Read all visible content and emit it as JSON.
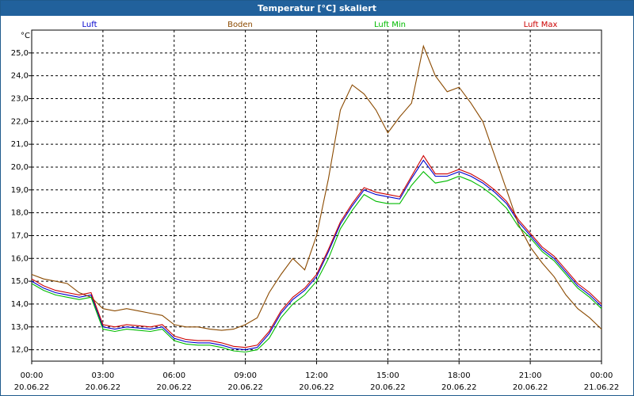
{
  "title": "Temperatur [°C] skaliert",
  "chart_data": {
    "type": "line",
    "title": "Temperatur [°C] skaliert",
    "ylabel": "°C",
    "xlabel": "",
    "ylim": [
      11.5,
      26.0
    ],
    "xlim": [
      0,
      24
    ],
    "grid": true,
    "legend": "top",
    "yticks": [
      "12,0",
      "13,0",
      "14,0",
      "15,0",
      "16,0",
      "17,0",
      "18,0",
      "19,0",
      "20,0",
      "21,0",
      "22,0",
      "23,0",
      "24,0",
      "25,0"
    ],
    "ytick_values": [
      12,
      13,
      14,
      15,
      16,
      17,
      18,
      19,
      20,
      21,
      22,
      23,
      24,
      25
    ],
    "xticks": [
      {
        "time": "00:00",
        "date": "20.06.22",
        "h": 0
      },
      {
        "time": "03:00",
        "date": "20.06.22",
        "h": 3
      },
      {
        "time": "06:00",
        "date": "20.06.22",
        "h": 6
      },
      {
        "time": "09:00",
        "date": "20.06.22",
        "h": 9
      },
      {
        "time": "12:00",
        "date": "20.06.22",
        "h": 12
      },
      {
        "time": "15:00",
        "date": "20.06.22",
        "h": 15
      },
      {
        "time": "18:00",
        "date": "20.06.22",
        "h": 18
      },
      {
        "time": "21:00",
        "date": "20.06.22",
        "h": 21
      },
      {
        "time": "00:00",
        "date": "21.06.22",
        "h": 24
      }
    ],
    "series": [
      {
        "name": "Luft",
        "color": "#0000cc",
        "points": [
          [
            0,
            15.0
          ],
          [
            0.5,
            14.7
          ],
          [
            1,
            14.5
          ],
          [
            1.5,
            14.4
          ],
          [
            2,
            14.3
          ],
          [
            2.5,
            14.4
          ],
          [
            3,
            13.0
          ],
          [
            3.5,
            12.9
          ],
          [
            4,
            13.0
          ],
          [
            4.5,
            12.95
          ],
          [
            5,
            12.9
          ],
          [
            5.5,
            13.0
          ],
          [
            6,
            12.5
          ],
          [
            6.5,
            12.35
          ],
          [
            7,
            12.3
          ],
          [
            7.5,
            12.3
          ],
          [
            8,
            12.2
          ],
          [
            8.5,
            12.05
          ],
          [
            9,
            12.0
          ],
          [
            9.5,
            12.1
          ],
          [
            10,
            12.7
          ],
          [
            10.5,
            13.6
          ],
          [
            11,
            14.2
          ],
          [
            11.5,
            14.6
          ],
          [
            12,
            15.2
          ],
          [
            12.5,
            16.3
          ],
          [
            13,
            17.5
          ],
          [
            13.5,
            18.3
          ],
          [
            14,
            19.0
          ],
          [
            14.5,
            18.8
          ],
          [
            15,
            18.7
          ],
          [
            15.5,
            18.6
          ],
          [
            16,
            19.5
          ],
          [
            16.5,
            20.3
          ],
          [
            17,
            19.6
          ],
          [
            17.5,
            19.6
          ],
          [
            18,
            19.8
          ],
          [
            18.5,
            19.6
          ],
          [
            19,
            19.3
          ],
          [
            19.5,
            18.9
          ],
          [
            20,
            18.4
          ],
          [
            20.5,
            17.6
          ],
          [
            21,
            17.0
          ],
          [
            21.5,
            16.4
          ],
          [
            22,
            16.0
          ],
          [
            22.5,
            15.4
          ],
          [
            23,
            14.8
          ],
          [
            23.5,
            14.4
          ],
          [
            24,
            13.9
          ]
        ]
      },
      {
        "name": "Boden",
        "color": "#8b4a00",
        "points": [
          [
            0,
            15.3
          ],
          [
            0.5,
            15.1
          ],
          [
            1,
            15.0
          ],
          [
            1.5,
            14.9
          ],
          [
            2,
            14.5
          ],
          [
            2.5,
            14.3
          ],
          [
            3,
            13.8
          ],
          [
            3.5,
            13.7
          ],
          [
            4,
            13.8
          ],
          [
            4.5,
            13.7
          ],
          [
            5,
            13.6
          ],
          [
            5.5,
            13.5
          ],
          [
            6,
            13.1
          ],
          [
            6.5,
            13.0
          ],
          [
            7,
            13.0
          ],
          [
            7.5,
            12.9
          ],
          [
            8,
            12.85
          ],
          [
            8.5,
            12.9
          ],
          [
            9,
            13.1
          ],
          [
            9.5,
            13.4
          ],
          [
            10,
            14.5
          ],
          [
            10.5,
            15.3
          ],
          [
            11,
            16.0
          ],
          [
            11.5,
            15.5
          ],
          [
            12,
            17.0
          ],
          [
            12.5,
            19.5
          ],
          [
            13,
            22.5
          ],
          [
            13.5,
            23.6
          ],
          [
            14,
            23.2
          ],
          [
            14.5,
            22.5
          ],
          [
            15,
            21.5
          ],
          [
            15.5,
            22.2
          ],
          [
            16,
            22.8
          ],
          [
            16.5,
            25.3
          ],
          [
            17,
            24.0
          ],
          [
            17.5,
            23.3
          ],
          [
            18,
            23.5
          ],
          [
            18.5,
            22.8
          ],
          [
            19,
            22.0
          ],
          [
            19.5,
            20.5
          ],
          [
            20,
            19.0
          ],
          [
            20.5,
            17.5
          ],
          [
            21,
            16.5
          ],
          [
            21.5,
            15.8
          ],
          [
            22,
            15.2
          ],
          [
            22.5,
            14.4
          ],
          [
            23,
            13.8
          ],
          [
            23.5,
            13.4
          ],
          [
            24,
            12.9
          ]
        ]
      },
      {
        "name": "Luft Min",
        "color": "#00bb00",
        "points": [
          [
            0,
            14.9
          ],
          [
            0.5,
            14.6
          ],
          [
            1,
            14.4
          ],
          [
            1.5,
            14.3
          ],
          [
            2,
            14.2
          ],
          [
            2.5,
            14.3
          ],
          [
            3,
            12.9
          ],
          [
            3.5,
            12.8
          ],
          [
            4,
            12.9
          ],
          [
            4.5,
            12.85
          ],
          [
            5,
            12.8
          ],
          [
            5.5,
            12.9
          ],
          [
            6,
            12.4
          ],
          [
            6.5,
            12.25
          ],
          [
            7,
            12.2
          ],
          [
            7.5,
            12.2
          ],
          [
            8,
            12.1
          ],
          [
            8.5,
            11.95
          ],
          [
            9,
            11.9
          ],
          [
            9.5,
            12.0
          ],
          [
            10,
            12.5
          ],
          [
            10.5,
            13.4
          ],
          [
            11,
            14.0
          ],
          [
            11.5,
            14.4
          ],
          [
            12,
            15.0
          ],
          [
            12.5,
            16.0
          ],
          [
            13,
            17.3
          ],
          [
            13.5,
            18.1
          ],
          [
            14,
            18.8
          ],
          [
            14.5,
            18.5
          ],
          [
            15,
            18.4
          ],
          [
            15.5,
            18.4
          ],
          [
            16,
            19.2
          ],
          [
            16.5,
            19.8
          ],
          [
            17,
            19.3
          ],
          [
            17.5,
            19.4
          ],
          [
            18,
            19.6
          ],
          [
            18.5,
            19.4
          ],
          [
            19,
            19.1
          ],
          [
            19.5,
            18.7
          ],
          [
            20,
            18.2
          ],
          [
            20.5,
            17.4
          ],
          [
            21,
            16.9
          ],
          [
            21.5,
            16.3
          ],
          [
            22,
            15.9
          ],
          [
            22.5,
            15.3
          ],
          [
            23,
            14.7
          ],
          [
            23.5,
            14.3
          ],
          [
            24,
            13.8
          ]
        ]
      },
      {
        "name": "Luft Max",
        "color": "#cc0000",
        "points": [
          [
            0,
            15.1
          ],
          [
            0.5,
            14.8
          ],
          [
            1,
            14.6
          ],
          [
            1.5,
            14.5
          ],
          [
            2,
            14.4
          ],
          [
            2.5,
            14.5
          ],
          [
            3,
            13.1
          ],
          [
            3.5,
            13.0
          ],
          [
            4,
            13.1
          ],
          [
            4.5,
            13.05
          ],
          [
            5,
            13.0
          ],
          [
            5.5,
            13.1
          ],
          [
            6,
            12.6
          ],
          [
            6.5,
            12.45
          ],
          [
            7,
            12.4
          ],
          [
            7.5,
            12.4
          ],
          [
            8,
            12.3
          ],
          [
            8.5,
            12.15
          ],
          [
            9,
            12.1
          ],
          [
            9.5,
            12.2
          ],
          [
            10,
            12.8
          ],
          [
            10.5,
            13.7
          ],
          [
            11,
            14.3
          ],
          [
            11.5,
            14.7
          ],
          [
            12,
            15.3
          ],
          [
            12.5,
            16.4
          ],
          [
            13,
            17.6
          ],
          [
            13.5,
            18.4
          ],
          [
            14,
            19.1
          ],
          [
            14.5,
            18.9
          ],
          [
            15,
            18.8
          ],
          [
            15.5,
            18.7
          ],
          [
            16,
            19.6
          ],
          [
            16.5,
            20.5
          ],
          [
            17,
            19.7
          ],
          [
            17.5,
            19.7
          ],
          [
            18,
            19.9
          ],
          [
            18.5,
            19.7
          ],
          [
            19,
            19.4
          ],
          [
            19.5,
            19.0
          ],
          [
            20,
            18.5
          ],
          [
            20.5,
            17.7
          ],
          [
            21,
            17.1
          ],
          [
            21.5,
            16.5
          ],
          [
            22,
            16.1
          ],
          [
            22.5,
            15.5
          ],
          [
            23,
            14.9
          ],
          [
            23.5,
            14.5
          ],
          [
            24,
            14.0
          ]
        ]
      }
    ]
  }
}
